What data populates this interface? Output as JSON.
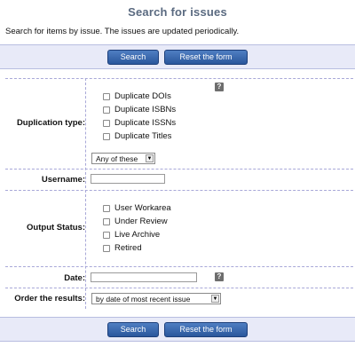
{
  "page": {
    "title": "Search for issues",
    "intro": "Search for items by issue. The issues are updated periodically."
  },
  "buttons": {
    "search_label": "Search",
    "reset_label": "Reset the form"
  },
  "form": {
    "duplication_type": {
      "label": "Duplication type:",
      "options": [
        "Duplicate DOIs",
        "Duplicate ISBNs",
        "Duplicate ISSNs",
        "Duplicate Titles"
      ],
      "match_select_value": "Any of these"
    },
    "username": {
      "label": "Username:",
      "value": ""
    },
    "output_status": {
      "label": "Output Status:",
      "options": [
        "User Workarea",
        "Under Review",
        "Live Archive",
        "Retired"
      ]
    },
    "date": {
      "label": "Date:",
      "value": ""
    },
    "order": {
      "label": "Order the results:",
      "selected": "by date of most recent issue"
    },
    "help_glyph": "?"
  },
  "icons": {
    "help": "help-icon",
    "dropdown": "chevron-down-icon"
  },
  "colors": {
    "title": "#5a6a80",
    "button_bar": "#e8eaf8",
    "button": "#2a579c",
    "help_icon": "#6e6e6e"
  }
}
